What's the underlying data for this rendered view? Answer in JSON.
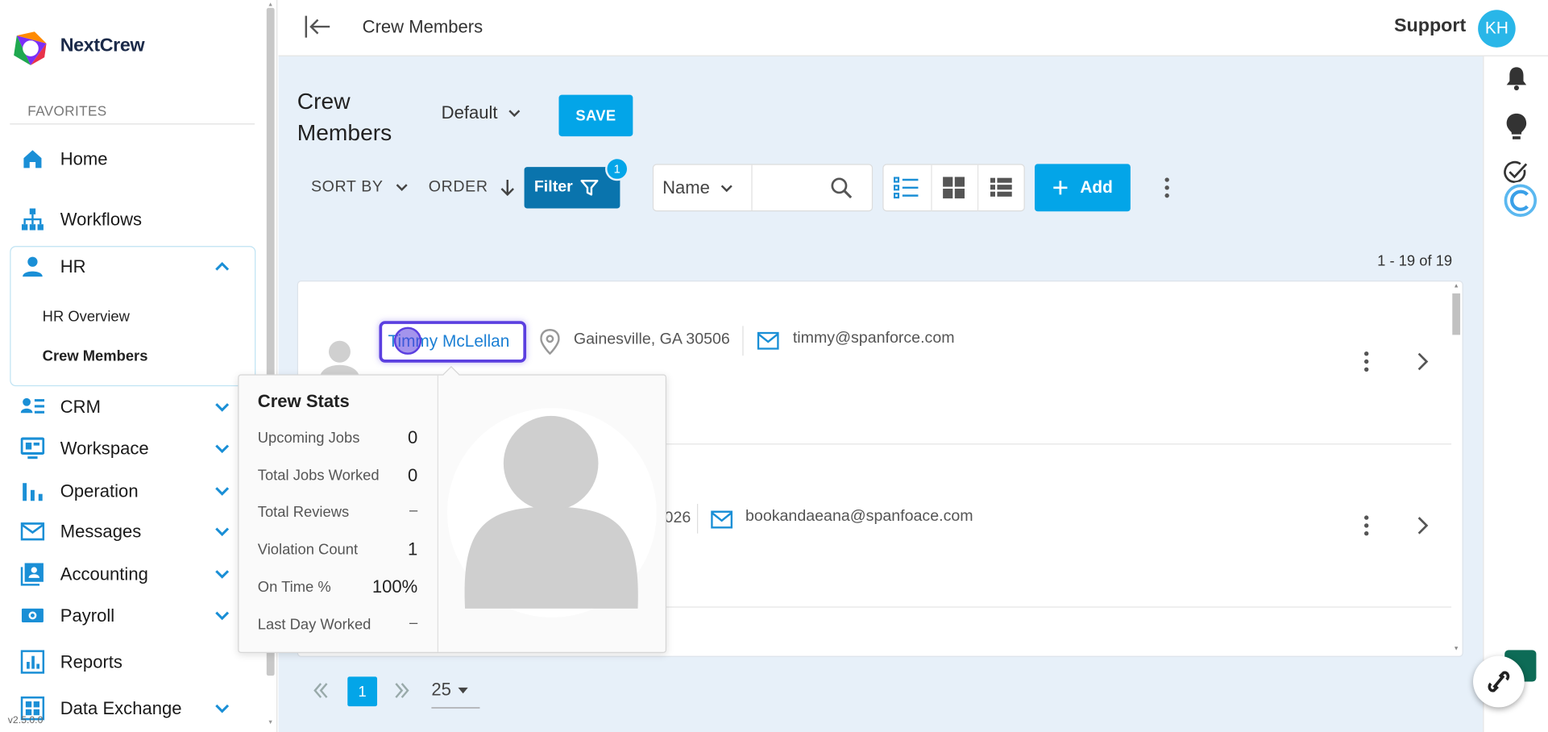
{
  "app": {
    "name": "NextCrew",
    "version": "v2.5.0.0"
  },
  "sidebar": {
    "favorites_label": "FAVORITES",
    "items": [
      {
        "label": "Home",
        "icon": "home-icon"
      },
      {
        "label": "Workflows",
        "icon": "sitemap-icon"
      },
      {
        "label": "HR",
        "icon": "person-icon",
        "expanded": true
      },
      {
        "label": "CRM",
        "icon": "contact-list-icon"
      },
      {
        "label": "Workspace",
        "icon": "monitor-icon"
      },
      {
        "label": "Operation",
        "icon": "bar-chart-icon"
      },
      {
        "label": "Messages",
        "icon": "mail-icon"
      },
      {
        "label": "Accounting",
        "icon": "contact-card-icon"
      },
      {
        "label": "Payroll",
        "icon": "money-icon"
      },
      {
        "label": "Reports",
        "icon": "report-icon"
      },
      {
        "label": "Data Exchange",
        "icon": "grid-icon"
      }
    ],
    "hr_sub": [
      {
        "label": "HR Overview",
        "active": false
      },
      {
        "label": "Crew Members",
        "active": true
      }
    ]
  },
  "topbar": {
    "title": "Crew Members",
    "support": "Support",
    "avatar_initials": "KH"
  },
  "page": {
    "title_line1": "Crew",
    "title_line2": "Members",
    "view_select": "Default",
    "save": "SAVE",
    "sort_by": "SORT BY",
    "order": "ORDER",
    "filter": "Filter",
    "filter_count": "1",
    "search_field": "Name",
    "add": "Add",
    "count": "1 - 19 of 19"
  },
  "rows": [
    {
      "name": "Timmy McLellan",
      "location": "Gainesville, GA 30506",
      "email": "timmy@spanforce.com"
    },
    {
      "name": "",
      "location": "026",
      "email": "bookandaeana@spanfoace.com"
    }
  ],
  "popup": {
    "title": "Crew Stats",
    "stats": [
      {
        "label": "Upcoming Jobs",
        "value": "0"
      },
      {
        "label": "Total Jobs Worked",
        "value": "0"
      },
      {
        "label": "Total Reviews",
        "value": "–"
      },
      {
        "label": "Violation Count",
        "value": "1"
      },
      {
        "label": "On Time %",
        "value": "100%"
      },
      {
        "label": "Last Day Worked",
        "value": "–"
      }
    ]
  },
  "pagination": {
    "current": "1",
    "per_page": "25"
  },
  "colors": {
    "accent": "#03a5e8",
    "filter": "#0a74ad",
    "focus": "#5b3fe0",
    "link": "#1b7fd4"
  }
}
